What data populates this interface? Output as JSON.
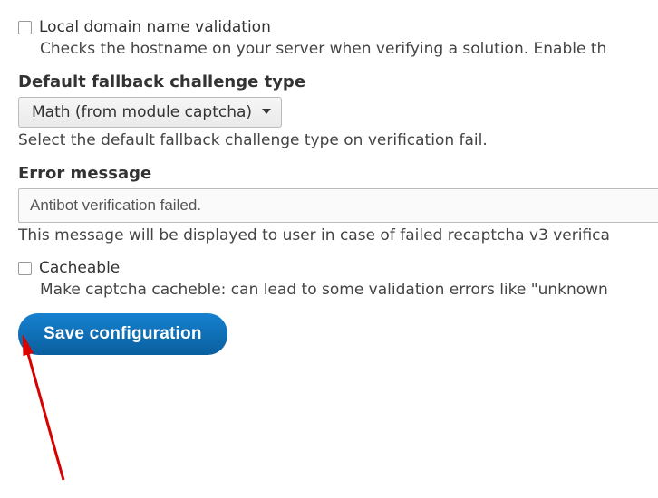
{
  "local_domain": {
    "label": "Local domain name validation",
    "desc": "Checks the hostname on your server when verifying a solution. Enable th"
  },
  "fallback": {
    "label": "Default fallback challenge type",
    "selected": "Math (from module captcha)",
    "help": "Select the default fallback challenge type on verification fail."
  },
  "error_message": {
    "label": "Error message",
    "value": "Antibot verification failed.",
    "help": "This message will be displayed to user in case of failed recaptcha v3 verifica"
  },
  "cacheable": {
    "label": "Cacheable",
    "desc": "Make captcha cacheble: can lead to some validation errors like \"unknown"
  },
  "actions": {
    "save": "Save configuration"
  }
}
